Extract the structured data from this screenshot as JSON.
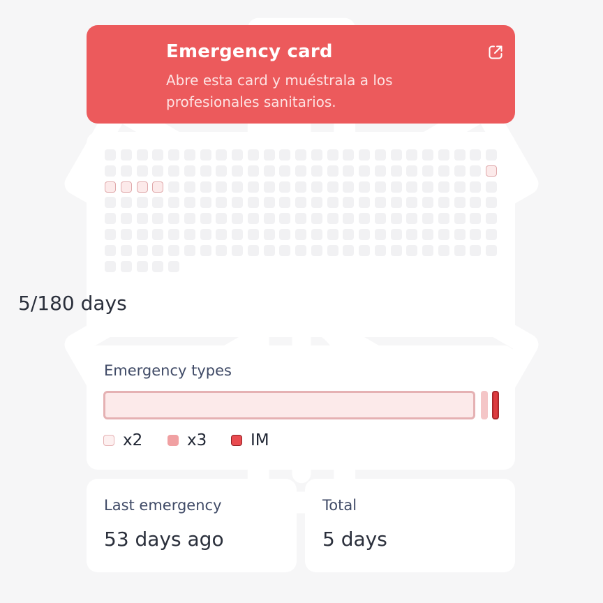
{
  "emergency_card": {
    "title": "Emergency card",
    "subtitle": "Abre esta card y muéstrala a los profesionales sanitarios.",
    "icon": "star-of-life-icon",
    "action_icon": "external-link-icon",
    "accent_color": "#ec5a5c"
  },
  "calendar": {
    "total_cells": 180,
    "active_range": [
      49,
      53
    ],
    "summary": "5/180 days"
  },
  "emergency_types": {
    "title": "Emergency types",
    "distribution": [
      {
        "label": "x2",
        "share": 0.94,
        "color": "#fceaea"
      },
      {
        "label": "x3",
        "share": 0.03,
        "color": "#f4c6c7"
      },
      {
        "label": "IM",
        "share": 0.03,
        "color": "#dd3b3f"
      }
    ],
    "legend": [
      {
        "label": "x2"
      },
      {
        "label": "x3"
      },
      {
        "label": "IM"
      }
    ]
  },
  "last_emergency": {
    "title": "Last emergency",
    "value": "53 days ago"
  },
  "total": {
    "title": "Total",
    "value": "5 days"
  }
}
